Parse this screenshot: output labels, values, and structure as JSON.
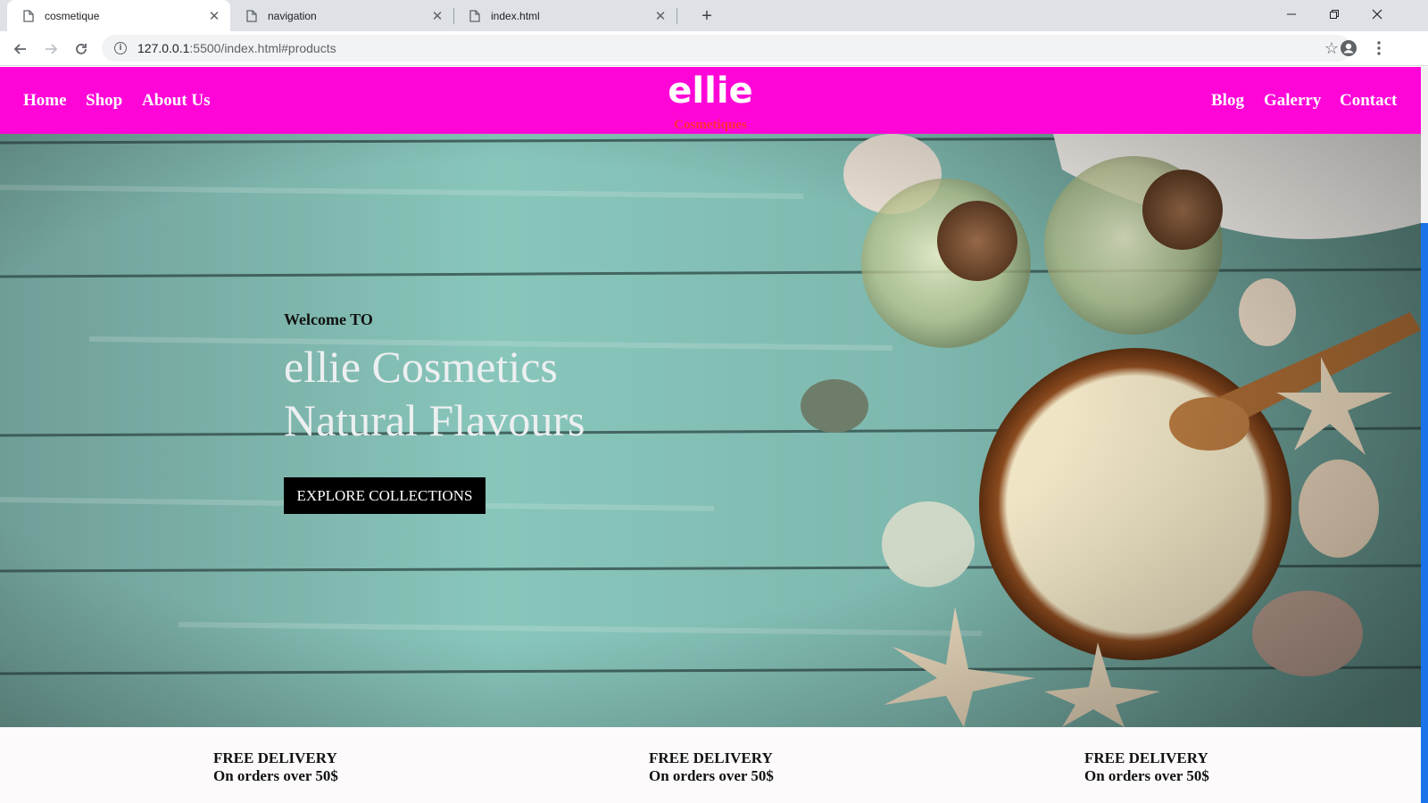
{
  "browser": {
    "tabs": [
      {
        "title": "cosmetique",
        "active": true
      },
      {
        "title": "navigation",
        "active": false
      },
      {
        "title": "index.html",
        "active": false
      }
    ],
    "url_host": "127.0.0.1",
    "url_rest": ":5500/index.html#products"
  },
  "header": {
    "nav_left": [
      "Home",
      "Shop",
      "About Us"
    ],
    "brand": "ellie",
    "brand_sub": "Cosmetiques",
    "nav_right": [
      "Blog",
      "Galerry",
      "Contact"
    ],
    "bg_color": "#ff05d8"
  },
  "hero": {
    "welcome": "Welcome TO",
    "line1": "ellie Cosmetics",
    "line2": "Natural Flavours",
    "cta": "EXPLORE COLLECTIONS"
  },
  "features": [
    {
      "title": "FREE DELIVERY",
      "subtitle": "On orders over 50$"
    },
    {
      "title": "FREE DELIVERY",
      "subtitle": "On orders over 50$"
    },
    {
      "title": "FREE DELIVERY",
      "subtitle": "On orders over 50$"
    }
  ]
}
